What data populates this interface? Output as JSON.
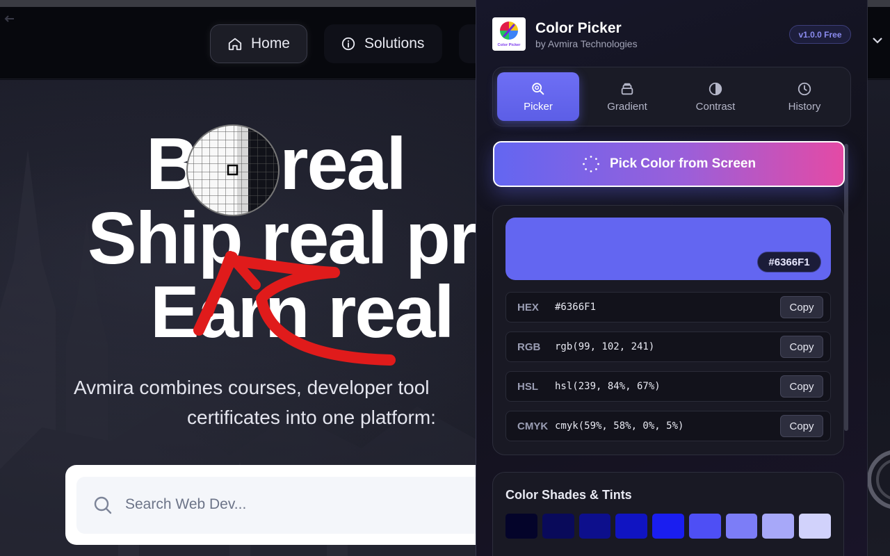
{
  "site": {
    "nav": {
      "home_label": "Home",
      "solutions_label": "Solutions"
    },
    "hero": {
      "line1": "B   d real",
      "line2": "Ship real pr",
      "line3": "Earn real",
      "sub_line1": "Avmira combines courses, developer tool",
      "sub_line2": "certificates into one platform:"
    },
    "search": {
      "placeholder": "Search Web Dev..."
    }
  },
  "popup": {
    "logo_text": "Color Picker",
    "title": "Color Picker",
    "subtitle": "by Avmira Technologies",
    "version_badge": "v1.0.0 Free",
    "tabs": [
      {
        "label": "Picker",
        "icon": "picker-icon",
        "active": true
      },
      {
        "label": "Gradient",
        "icon": "gradient-icon",
        "active": false
      },
      {
        "label": "Contrast",
        "icon": "contrast-icon",
        "active": false
      },
      {
        "label": "History",
        "icon": "history-icon",
        "active": false
      }
    ],
    "pick_button_label": "Pick Color from Screen",
    "current_color": "#6366F1",
    "values": [
      {
        "label": "HEX",
        "value": "#6366F1",
        "copy": "Copy"
      },
      {
        "label": "RGB",
        "value": "rgb(99, 102, 241)",
        "copy": "Copy"
      },
      {
        "label": "HSL",
        "value": "hsl(239, 84%, 67%)",
        "copy": "Copy"
      },
      {
        "label": "CMYK",
        "value": "cmyk(59%, 58%, 0%, 5%)",
        "copy": "Copy"
      }
    ],
    "shades_title": "Color Shades & Tints",
    "shades": [
      "#04042a",
      "#090a5a",
      "#0d0f8c",
      "#1014c2",
      "#1a1ef0",
      "#4e4ff5",
      "#7c7df7",
      "#a7a8f9",
      "#d1d2fb"
    ]
  },
  "colors": {
    "accent": "#6366f1",
    "pink": "#e44aa5",
    "annotation_red": "#e01b1b"
  }
}
